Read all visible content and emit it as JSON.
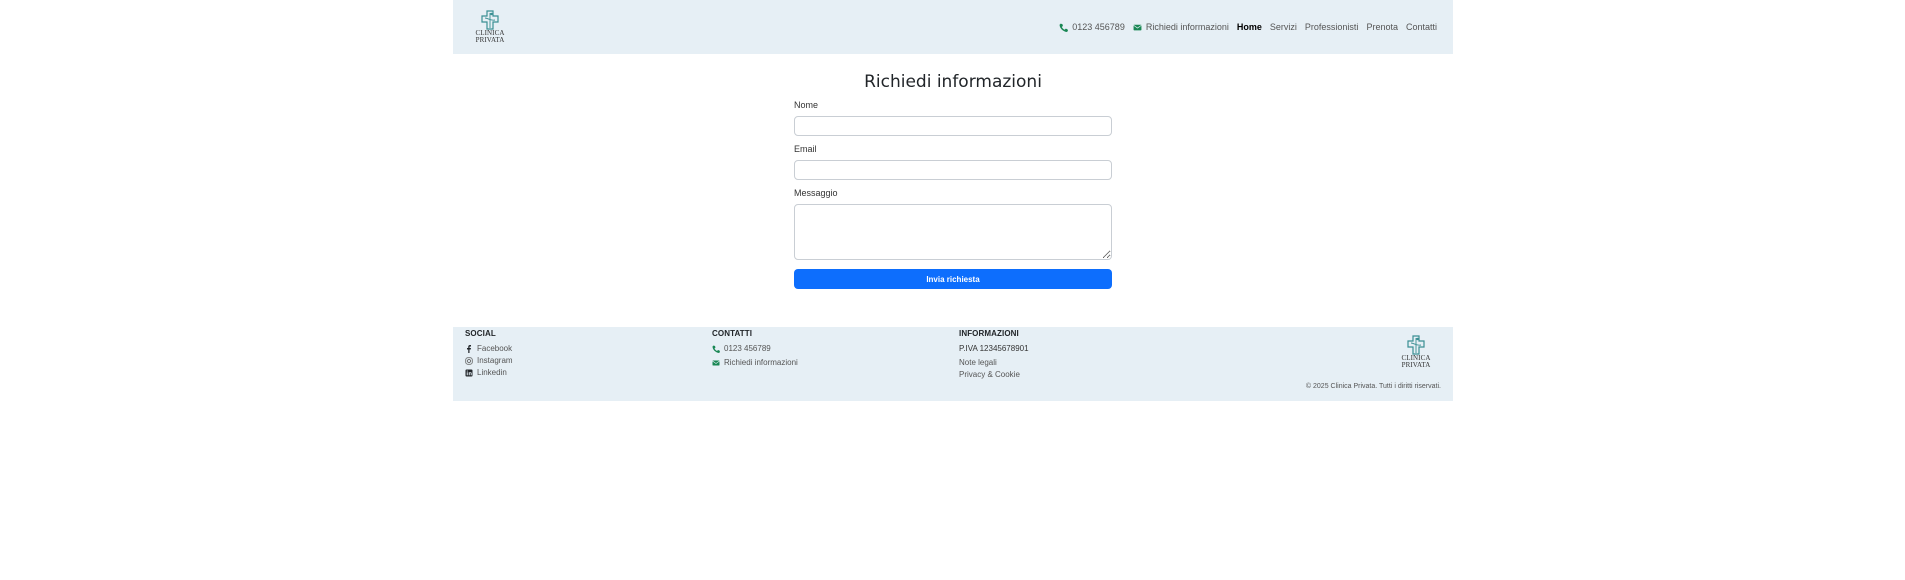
{
  "brand": {
    "line1": "CLINICA",
    "line2": "PRIVATA",
    "color": "#3a8f93"
  },
  "nav": {
    "phone": "0123 456789",
    "info": "Richiedi informazioni",
    "items": [
      "Home",
      "Servizi",
      "Professionisti",
      "Prenota",
      "Contatti"
    ],
    "active": "Home",
    "icon_color": "#198754"
  },
  "form": {
    "title": "Richiedi informazioni",
    "name_label": "Nome",
    "name_value": "",
    "email_label": "Email",
    "email_value": "",
    "message_label": "Messaggio",
    "message_value": "",
    "submit_label": "Invia richiesta",
    "accent": "#0d6efd"
  },
  "footer": {
    "social": {
      "heading": "SOCIAL",
      "items": [
        {
          "label": "Facebook",
          "icon": "facebook-icon"
        },
        {
          "label": "Instagram",
          "icon": "instagram-icon"
        },
        {
          "label": "Linkedin",
          "icon": "linkedin-icon"
        }
      ]
    },
    "contacts": {
      "heading": "CONTATTI",
      "phone": "0123 456789",
      "info": "Richiedi informazioni"
    },
    "info": {
      "heading": "INFORMAZIONI",
      "vat": "P.IVA 12345678901",
      "links": [
        "Note legali",
        "Privacy & Cookie"
      ]
    },
    "copyright": "© 2025 Clinica Privata. Tutti i diritti riservati."
  }
}
